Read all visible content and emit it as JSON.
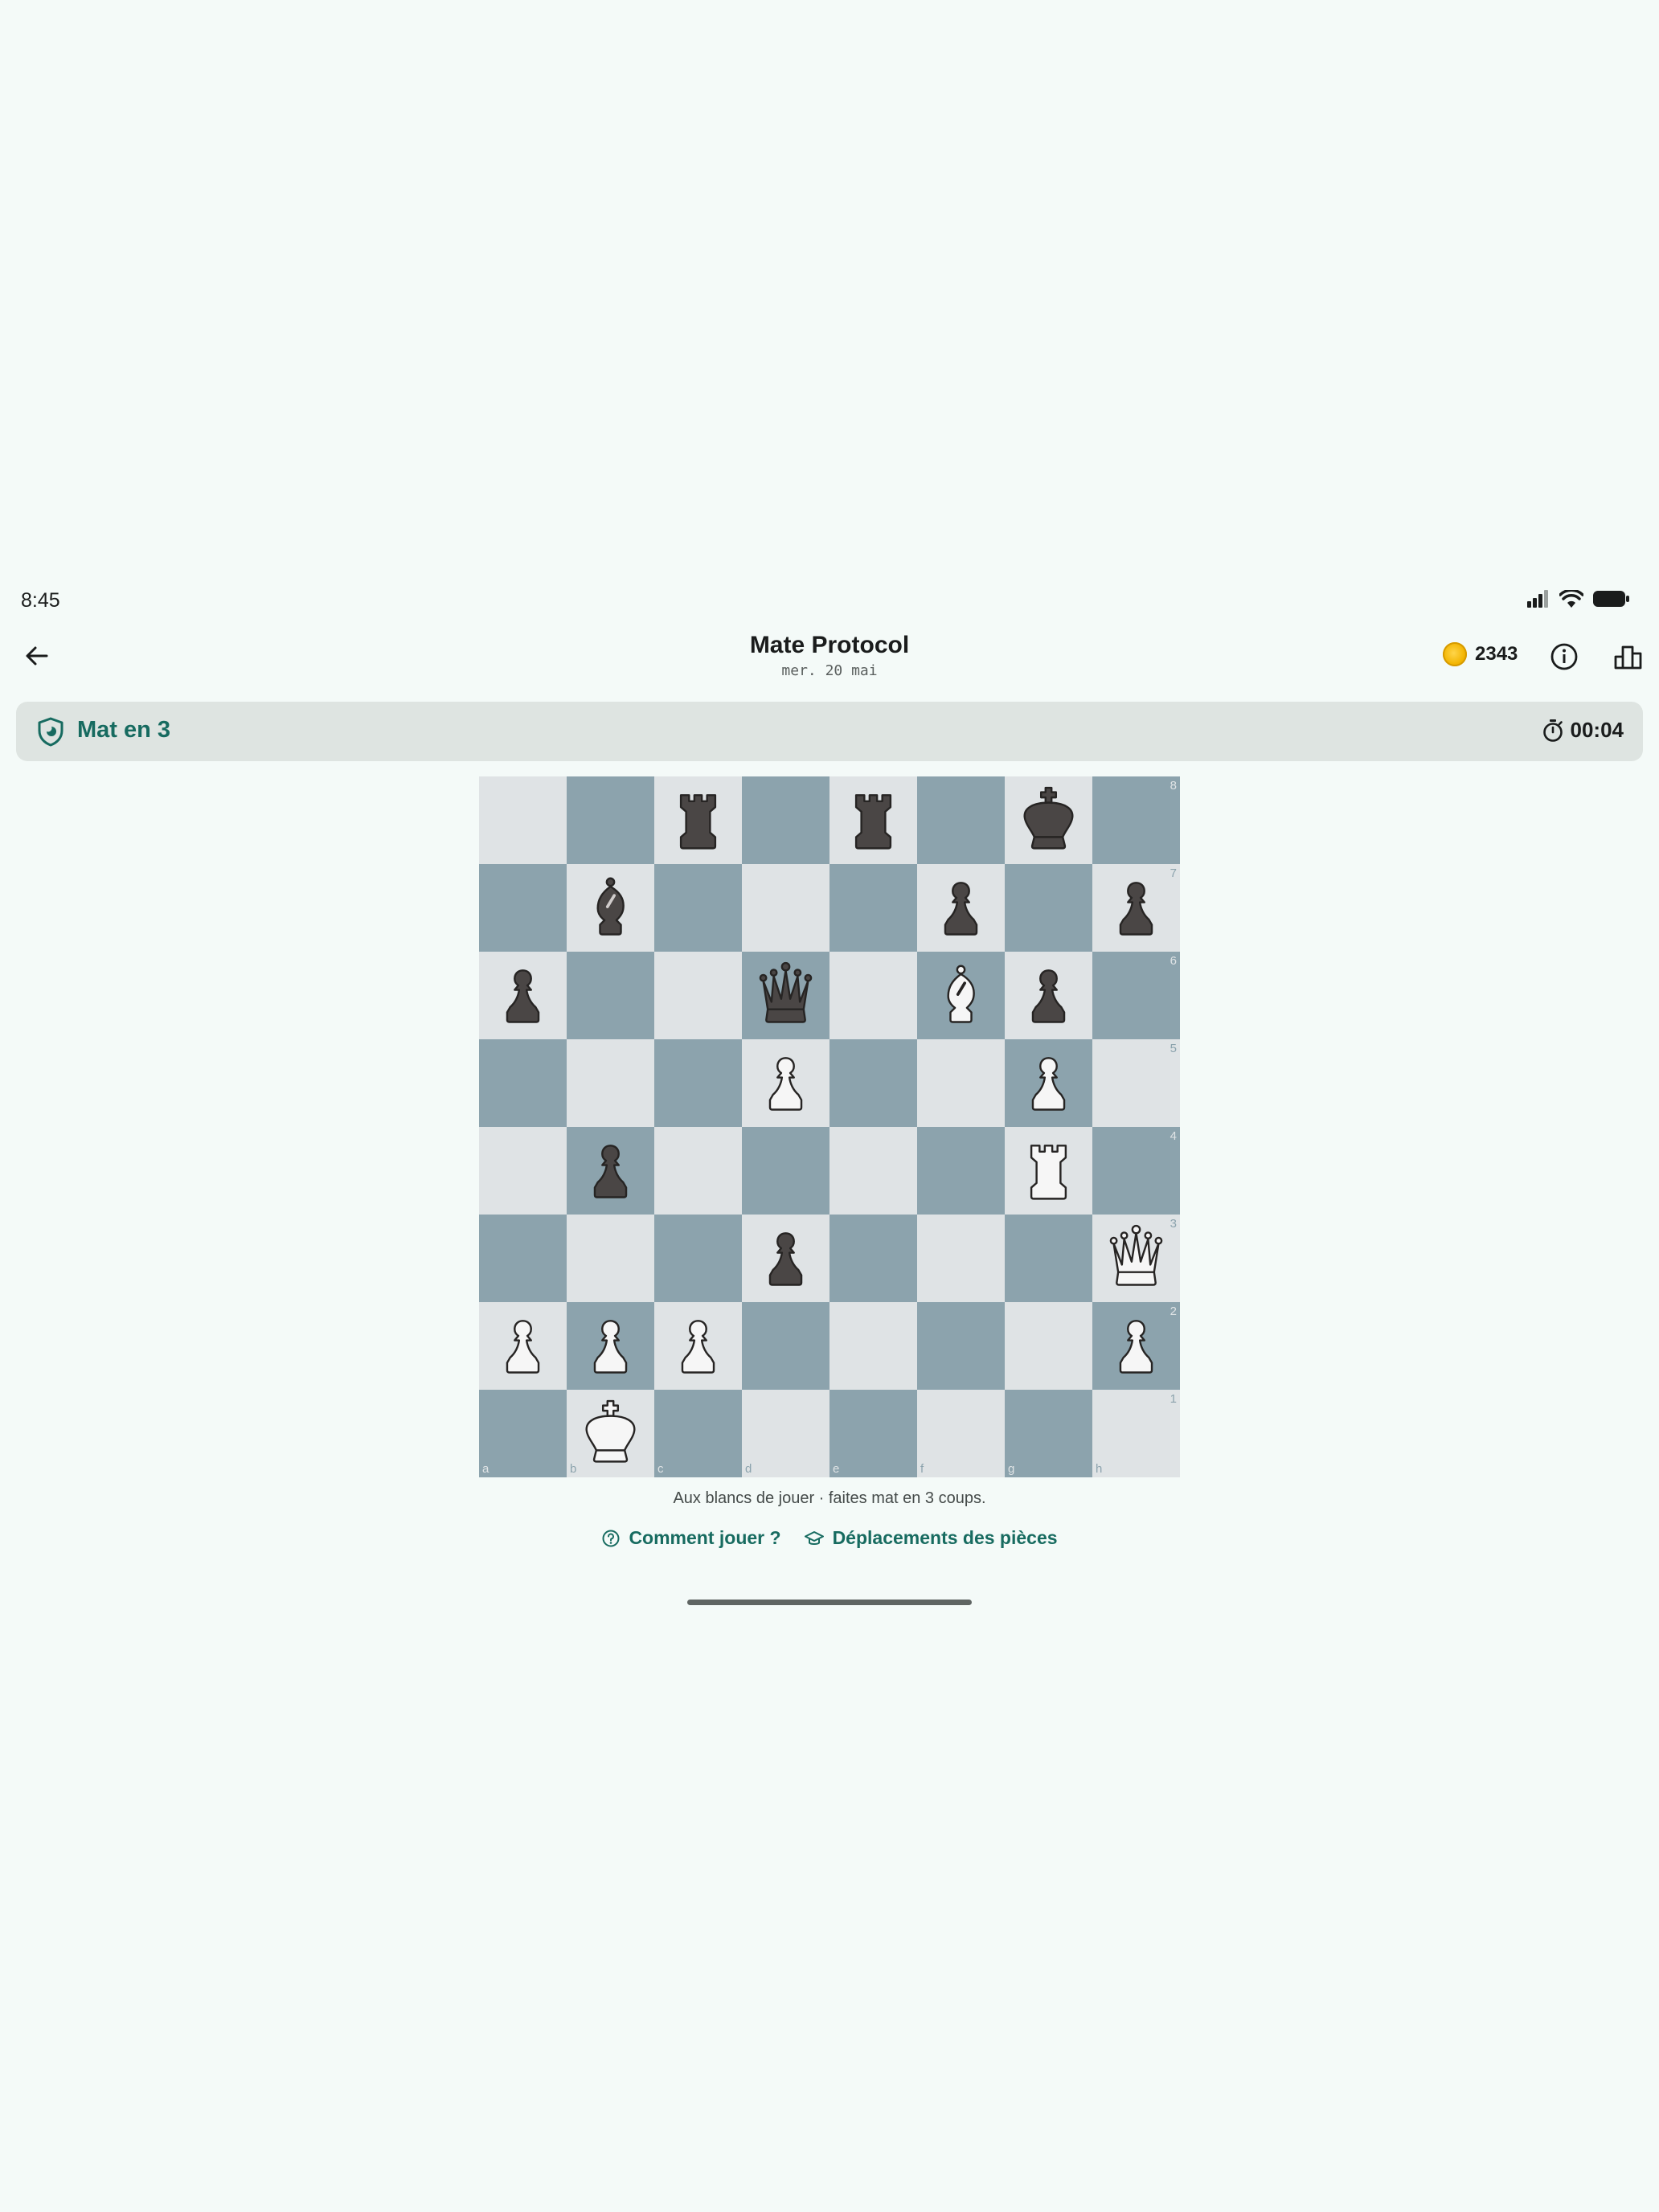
{
  "status_bar": {
    "time": "8:45"
  },
  "header": {
    "title": "Mate Protocol",
    "date": "mer. 20 mai",
    "coins": "2343",
    "back_icon": "arrow-left-icon",
    "info_icon": "info-icon",
    "stats_icon": "leaderboard-icon"
  },
  "puzzle": {
    "label": "Mat en 3",
    "timer": "00:04",
    "accent_color": "#176b60"
  },
  "board": {
    "light_color": "#dfe3e5",
    "dark_color": "#8ca3ad",
    "files": [
      "a",
      "b",
      "c",
      "d",
      "e",
      "f",
      "g",
      "h"
    ],
    "ranks": [
      "8",
      "7",
      "6",
      "5",
      "4",
      "3",
      "2",
      "1"
    ],
    "position": [
      [
        "",
        "",
        "r",
        "",
        "r",
        "",
        "k",
        ""
      ],
      [
        "",
        "b",
        "",
        "",
        "",
        "p",
        "",
        "p"
      ],
      [
        "p",
        "",
        "",
        "q",
        "",
        "B",
        "p",
        ""
      ],
      [
        "",
        "",
        "",
        "P",
        "",
        "",
        "P",
        ""
      ],
      [
        "",
        "p",
        "",
        "",
        "",
        "",
        "R",
        ""
      ],
      [
        "",
        "",
        "",
        "p",
        "",
        "",
        "",
        "Q"
      ],
      [
        "P",
        "P",
        "P",
        "",
        "",
        "",
        "",
        "P"
      ],
      [
        "",
        "K",
        "",
        "",
        "",
        "",
        "",
        ""
      ]
    ]
  },
  "footer": {
    "hint": "Aux blancs de jouer · faites mat en 3 coups.",
    "how_to_play": "Comment jouer ?",
    "piece_moves": "Déplacements des pièces"
  }
}
